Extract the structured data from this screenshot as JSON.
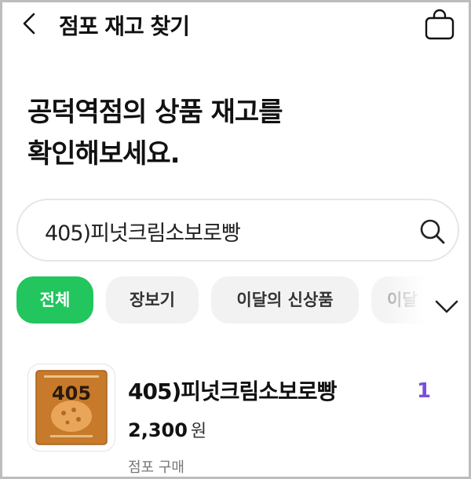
{
  "header": {
    "title": "점포 재고 찾기",
    "back_icon": "chevron-left-icon",
    "bag_icon": "shopping-bag-icon"
  },
  "headline": {
    "line1": "공덕역점의 상품 재고를",
    "line2": "확인해보세요."
  },
  "search": {
    "value": "405)피넛크림소보로빵",
    "icon": "search-icon"
  },
  "chips": [
    {
      "label": "전체",
      "active": true
    },
    {
      "label": "장보기",
      "active": false
    },
    {
      "label": "이달의 신상품",
      "active": false
    },
    {
      "label": "이달",
      "active": false
    }
  ],
  "expand_icon": "chevron-down-icon",
  "product": {
    "name": "405)피넛크림소보로빵",
    "price": "2,300",
    "currency": "원",
    "purchase_type": "점포 구매",
    "stock_count": "1",
    "package_text": "405"
  },
  "colors": {
    "accent_green": "#22c55e",
    "count_purple": "#7c4ddc"
  }
}
